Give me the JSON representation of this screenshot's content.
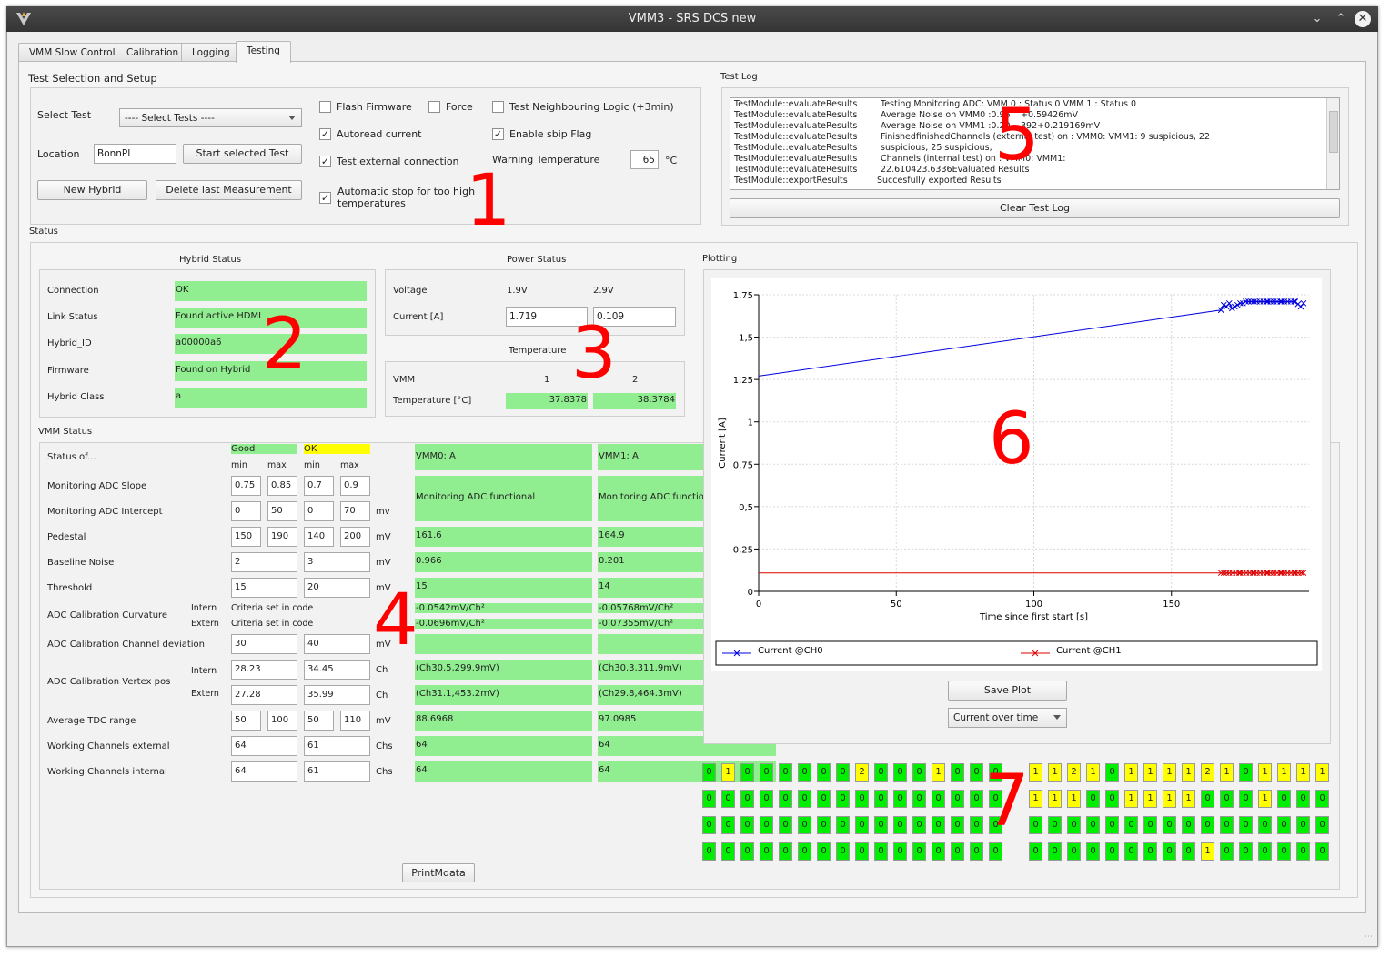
{
  "window": {
    "title": "VMM3 - SRS DCS new"
  },
  "tabs": [
    "VMM Slow Control",
    "Calibration",
    "Logging",
    "Testing"
  ],
  "setup": {
    "group_title": "Test Selection and Setup",
    "select_test_label": "Select Test",
    "select_test_value": "---- Select Tests ----",
    "location_label": "Location",
    "location_value": "BonnPI",
    "start_button": "Start selected Test",
    "new_hybrid_button": "New Hybrid",
    "delete_button": "Delete last Measurement",
    "flash_firmware": "Flash Firmware",
    "force": "Force",
    "test_neighbouring": "Test Neighbouring Logic (+3min)",
    "autoread_current": "Autoread current",
    "enable_sbip": "Enable sbip Flag",
    "test_external": "Test external connection",
    "warning_temp_label": "Warning Temperature",
    "warning_temp_value": "65",
    "warning_temp_unit": "°C",
    "auto_stop_1": "Automatic stop for too high",
    "auto_stop_2": "temperatures"
  },
  "testlog": {
    "title": "Test Log",
    "lines": [
      [
        "TestModule::evaluateResults",
        "Testing Monitoring ADC:     VMM 0 : Status 0     VMM 1 : Status 0"
      ],
      [
        "TestModule::evaluateResults",
        "Average Noise on VMM0 :0.96",
        "+0.59426mV"
      ],
      [
        "TestModule::evaluateResults",
        "Average Noise on VMM1 :0.20",
        "392+0.219169mV"
      ],
      [
        "TestModule::evaluateResults",
        "FinishedfinishedChannels (external test) on : VMM0: VMM1: 9 suspicious, 22"
      ],
      [
        "TestModule::evaluateResults",
        "suspicious, 25 suspicious,"
      ],
      [
        "TestModule::evaluateResults",
        "Channels (internal test) on : VMM0: VMM1:"
      ],
      [
        "TestModule::evaluateResults",
        "22.610423.6336Evaluated Results"
      ],
      [
        "TestModule::exportResults",
        "Succesfully exported Results"
      ]
    ],
    "clear_button": "Clear Test Log"
  },
  "status_title": "Status",
  "hybrid": {
    "title": "Hybrid Status",
    "rows": [
      {
        "label": "Connection",
        "value": "OK"
      },
      {
        "label": "Link Status",
        "value": "Found active HDMI"
      },
      {
        "label": "Hybrid_ID",
        "value": "a00000a6"
      },
      {
        "label": "Firmware",
        "value": "Found on Hybrid"
      },
      {
        "label": "Hybrid Class",
        "value": "a"
      }
    ]
  },
  "power": {
    "title": "Power Status",
    "voltage_label": "Voltage",
    "v1": "1.9V",
    "v2": "2.9V",
    "current_label": "Current [A]",
    "c1": "1.719",
    "c2": "0.109"
  },
  "temperature": {
    "title": "Temperature",
    "vmm_label": "VMM",
    "n1": "1",
    "n2": "2",
    "temp_label": "Temperature [°C]",
    "t1": "37.8378",
    "t2": "38.3784"
  },
  "vmm": {
    "title": "VMM Status",
    "status_of": "Status of...",
    "good": "Good",
    "ok": "OK",
    "min": "min",
    "max": "max",
    "vmm0_header": "VMM0: A",
    "vmm1_header": "VMM1: A",
    "intern": "Intern",
    "extern": "Extern",
    "rows": [
      {
        "label": "Monitoring ADC Slope",
        "a": "0.75",
        "b": "0.85",
        "c": "0.7",
        "d": "0.9",
        "unit": ""
      },
      {
        "label": "Monitoring ADC Intercept",
        "a": "0",
        "b": "50",
        "c": "0",
        "d": "70",
        "unit": "mv"
      },
      {
        "label": "Pedestal",
        "a": "150",
        "b": "190",
        "c": "140",
        "d": "200",
        "unit": "mV",
        "r0": "161.6",
        "r1": "164.9"
      },
      {
        "label": "Baseline Noise",
        "g": "2",
        "o": "3",
        "unit": "mV",
        "r0": "0.966",
        "r1": "0.201"
      },
      {
        "label": "Threshold",
        "g": "15",
        "o": "20",
        "unit": "mV",
        "r0": "15",
        "r1": "14"
      },
      {
        "label": "ADC Calibration Curvature",
        "crit": "Criteria set in code",
        "ri0": "-0.0542mV/Ch²",
        "ri1": "-0.05768mV/Ch²",
        "re0": "-0.0696mV/Ch²",
        "re1": "-0.07355mV/Ch²"
      },
      {
        "label": "ADC Calibration Channel deviation",
        "g": "30",
        "o": "40",
        "unit": "mV"
      },
      {
        "label": "ADC Calibration Vertex pos",
        "gi": "28.23",
        "oi": "34.45",
        "ge": "27.28",
        "oe": "35.99",
        "unit": "Ch",
        "ri0": "(Ch30.5,299.9mV)",
        "ri1": "(Ch30.3,311.9mV)",
        "re0": "(Ch31.1,453.2mV)",
        "re1": "(Ch29.8,464.3mV)"
      },
      {
        "label": "Average TDC range",
        "a": "50",
        "b": "100",
        "c": "50",
        "d": "110",
        "unit": "mV",
        "r0": "88.6968",
        "r1": "97.0985"
      },
      {
        "label": "Working Channels external",
        "g": "64",
        "o": "61",
        "unit": "Chs",
        "r0": "64",
        "r1": "64"
      },
      {
        "label": "Working Channels internal",
        "g": "64",
        "o": "61",
        "unit": "Chs",
        "r0": "64",
        "r1": "64"
      }
    ],
    "monitoring_text": "Monitoring ADC functional",
    "print_button": "PrintMdata"
  },
  "plotting": {
    "title": "Plotting",
    "save_button": "Save Plot",
    "combo_value": "Current over time"
  },
  "chart_data": {
    "type": "line",
    "title": "",
    "xlabel": "Time since first start [s]",
    "ylabel": "Current [A]",
    "xlim": [
      0,
      200
    ],
    "ylim": [
      0,
      1.75
    ],
    "xticks": [
      "0",
      "50",
      "100",
      "150"
    ],
    "yticks": [
      "0",
      "0,25",
      "0,5",
      "0,75",
      "1",
      "1,25",
      "1,5",
      "1,75"
    ],
    "grid": true,
    "legend": "bottom",
    "series": [
      {
        "name": "Current @CH0",
        "color": "#0000dd",
        "x": [
          0,
          168,
          169,
          170,
          171,
          172,
          173,
          174,
          175,
          176,
          177,
          178,
          180,
          185,
          190,
          195,
          197,
          198
        ],
        "y": [
          1.27,
          1.66,
          1.69,
          1.68,
          1.7,
          1.67,
          1.68,
          1.69,
          1.7,
          1.7,
          1.71,
          1.71,
          1.71,
          1.71,
          1.71,
          1.71,
          1.68,
          1.7
        ]
      },
      {
        "name": "Current @CH1",
        "color": "#dd0000",
        "x": [
          0,
          168,
          170,
          175,
          180,
          185,
          190,
          195,
          198
        ],
        "y": [
          0.109,
          0.109,
          0.109,
          0.109,
          0.109,
          0.109,
          0.109,
          0.109,
          0.109
        ]
      }
    ]
  },
  "channels": {
    "vmm0": [
      [
        "0",
        "1",
        "0",
        "0",
        "0",
        "0",
        "0",
        "0",
        "2",
        "0",
        "0",
        "0",
        "1",
        "0",
        "0",
        "0"
      ],
      [
        "0",
        "0",
        "0",
        "0",
        "0",
        "0",
        "0",
        "0",
        "0",
        "0",
        "0",
        "0",
        "0",
        "0",
        "0",
        "0"
      ],
      [
        "0",
        "0",
        "0",
        "0",
        "0",
        "0",
        "0",
        "0",
        "0",
        "0",
        "0",
        "0",
        "0",
        "0",
        "0",
        "0"
      ],
      [
        "0",
        "0",
        "0",
        "0",
        "0",
        "0",
        "0",
        "0",
        "0",
        "0",
        "0",
        "0",
        "0",
        "0",
        "0",
        "0"
      ]
    ],
    "vmm1": [
      [
        "1",
        "1",
        "2",
        "1",
        "0",
        "1",
        "1",
        "1",
        "1",
        "2",
        "1",
        "0",
        "1",
        "1",
        "1",
        "1"
      ],
      [
        "1",
        "1",
        "1",
        "0",
        "0",
        "1",
        "1",
        "1",
        "1",
        "0",
        "0",
        "0",
        "1",
        "0",
        "0",
        "0"
      ],
      [
        "0",
        "0",
        "0",
        "0",
        "0",
        "0",
        "0",
        "0",
        "0",
        "0",
        "0",
        "0",
        "0",
        "0",
        "0",
        "0"
      ],
      [
        "0",
        "0",
        "0",
        "0",
        "0",
        "0",
        "0",
        "0",
        "0",
        "1",
        "0",
        "0",
        "0",
        "0",
        "0",
        "0"
      ]
    ]
  },
  "annotations": [
    "1",
    "2",
    "3",
    "4",
    "5",
    "6",
    "7"
  ]
}
